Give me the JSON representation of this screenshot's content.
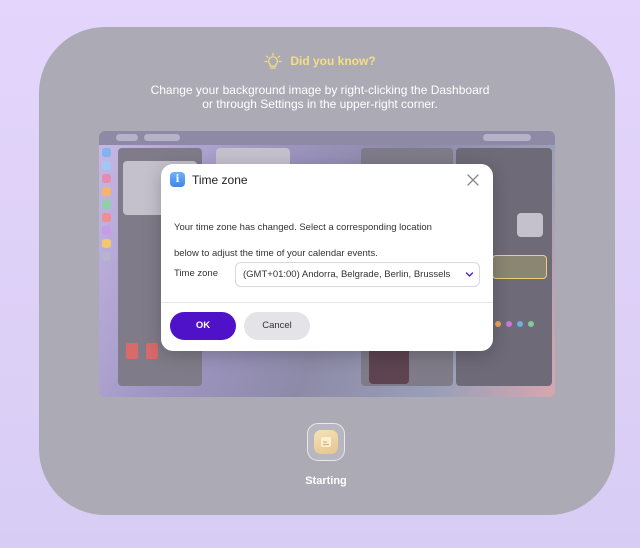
{
  "tip": {
    "heading": "Did you know?",
    "text_line1": "Change your background image by right-clicking the Dashboard",
    "text_line2": "or through Settings in the upper-right corner."
  },
  "dialog": {
    "title": "Time zone",
    "message_line1": "Your time zone has changed. Select a corresponding location",
    "message_line2": "below to adjust the time of your calendar events.",
    "timezone_label": "Time zone",
    "timezone_value": "(GMT+01:00) Andorra, Belgrade, Berlin, Brussels",
    "ok_label": "OK",
    "cancel_label": "Cancel",
    "accent_color": "#5012c9"
  },
  "footer": {
    "status_label": "Starting"
  },
  "icons": [
    "lightbulb-icon",
    "info-icon",
    "close-icon",
    "chevron-down-icon",
    "app-logo-icon"
  ]
}
